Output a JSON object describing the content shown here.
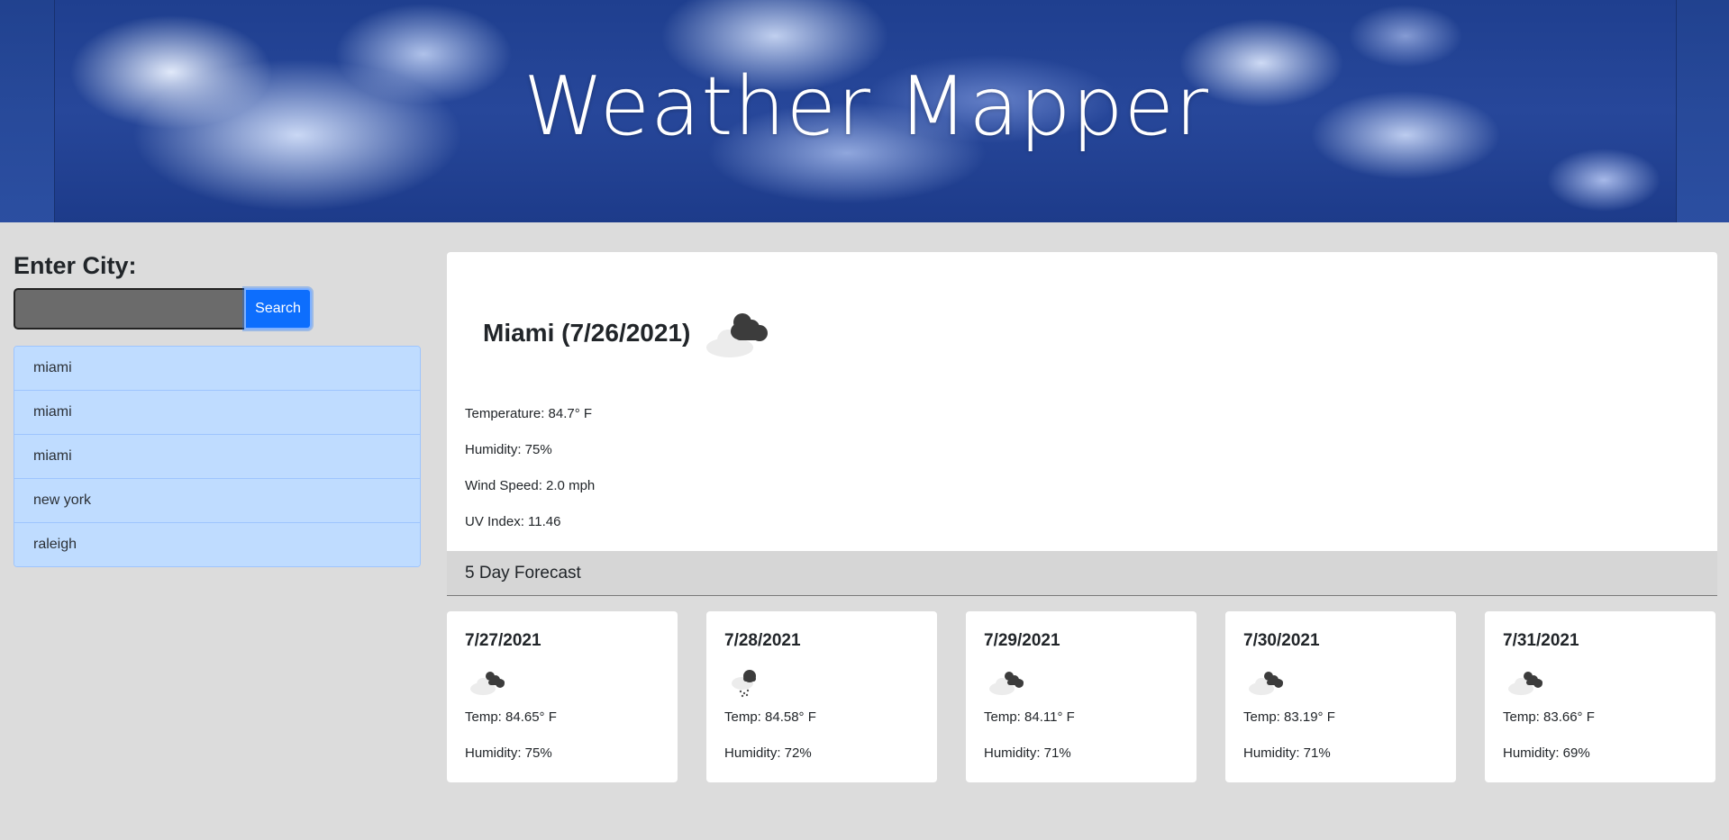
{
  "header": {
    "title": "Weather Mapper"
  },
  "sidebar": {
    "label": "Enter City:",
    "search": {
      "value": "",
      "placeholder": ""
    },
    "search_button": "Search",
    "history": [
      {
        "label": "miami"
      },
      {
        "label": "miami"
      },
      {
        "label": "miami"
      },
      {
        "label": "new york"
      },
      {
        "label": "raleigh"
      }
    ]
  },
  "current": {
    "title": "Miami (7/26/2021)",
    "icon": "cloudy-icon",
    "temperature": "Temperature: 84.7° F",
    "humidity": "Humidity: 75%",
    "wind": "Wind Speed: 2.0 mph",
    "uv": "UV Index: 11.46"
  },
  "forecast": {
    "heading": "5 Day Forecast",
    "days": [
      {
        "date": "7/27/2021",
        "icon": "cloudy-icon",
        "temp": "Temp: 84.65° F",
        "humidity": "Humidity: 75%"
      },
      {
        "date": "7/28/2021",
        "icon": "rain-icon",
        "temp": "Temp: 84.58° F",
        "humidity": "Humidity: 72%"
      },
      {
        "date": "7/29/2021",
        "icon": "cloudy-icon",
        "temp": "Temp: 84.11° F",
        "humidity": "Humidity: 71%"
      },
      {
        "date": "7/30/2021",
        "icon": "cloudy-icon",
        "temp": "Temp: 83.19° F",
        "humidity": "Humidity: 71%"
      },
      {
        "date": "7/31/2021",
        "icon": "cloudy-icon",
        "temp": "Temp: 83.66° F",
        "humidity": "Humidity: 69%"
      }
    ]
  },
  "colors": {
    "background": "#dcdcdc",
    "search_button": "#0d6efd",
    "history_item": "#bfdcff",
    "forecast_bar": "#d6d6d6"
  }
}
